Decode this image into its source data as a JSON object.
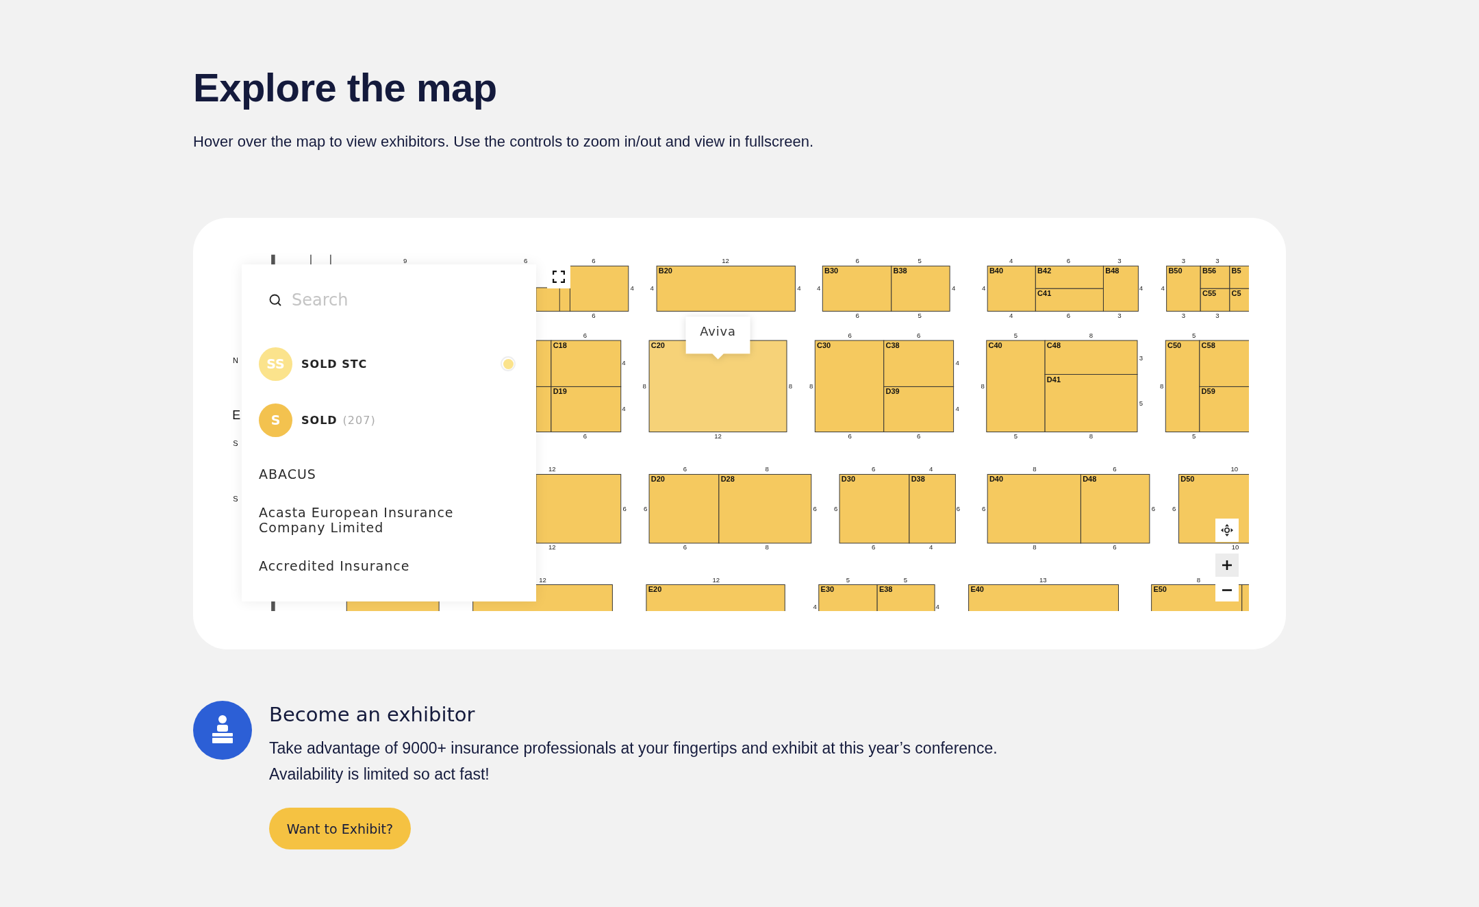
{
  "page": {
    "title": "Explore the map",
    "intro": "Hover over the map to view exhibitors. Use the controls to zoom in/out and view in fullscreen."
  },
  "map": {
    "search": {
      "placeholder": "Search"
    },
    "legend": [
      {
        "initials": "SS",
        "label": "SOLD STC",
        "color": "#fbe38c",
        "selected": true
      },
      {
        "initials": "S",
        "label": "SOLD",
        "count": "(207)",
        "color": "#f3c24f",
        "selected": false
      }
    ],
    "exhibitors": [
      "ABACUS",
      "Acasta European Insurance Company Limited",
      "Accredited Insurance"
    ],
    "edge_labels": [
      "N",
      "E",
      "S",
      "S"
    ],
    "tooltip": "Aviva",
    "stands": [
      {
        "booths": [
          {
            "highlighted": false
          },
          {
            "highlighted": false
          }
        ],
        "dims": [
          "6",
          "6",
          "4",
          "6"
        ]
      },
      {
        "booths": [
          {
            "label": "B20",
            "highlighted": false
          }
        ],
        "dims": [
          "12",
          "4",
          "4"
        ]
      },
      {
        "booths": [
          {
            "label": "B30",
            "highlighted": false
          },
          {
            "label": "B38",
            "highlighted": false
          }
        ],
        "dims": [
          "6",
          "5",
          "4",
          "4",
          "6",
          "5"
        ]
      },
      {
        "booths": [
          {
            "label": "B40",
            "highlighted": false
          },
          {
            "label": "B42",
            "highlighted": false
          },
          {
            "label": "C41",
            "highlighted": false
          },
          {
            "label": "B48",
            "highlighted": false
          }
        ],
        "dims": [
          "4",
          "6",
          "3",
          "4",
          "4",
          "4",
          "6",
          "3"
        ]
      },
      {
        "booths": [
          {
            "label": "B50",
            "highlighted": false
          },
          {
            "label": "B56",
            "highlighted": false
          },
          {
            "label": "C55",
            "highlighted": false
          },
          {
            "label": "B5",
            "highlighted": false
          },
          {
            "label": "C5",
            "highlighted": false
          }
        ],
        "dims": [
          "3",
          "3",
          "4",
          "3",
          "3"
        ]
      },
      {
        "booths": [
          {
            "highlighted": false
          },
          {
            "highlighted": false
          },
          {
            "label": "C18",
            "highlighted": false
          },
          {
            "label": "D19",
            "highlighted": false
          }
        ],
        "dims": [
          "6",
          "4",
          "4",
          "6"
        ]
      },
      {
        "booths": [
          {
            "label": "C20",
            "highlighted": true
          }
        ],
        "dims": [
          "8",
          "8",
          "12"
        ]
      },
      {
        "booths": [
          {
            "label": "C30",
            "highlighted": false
          },
          {
            "label": "C38",
            "highlighted": false
          },
          {
            "label": "D39",
            "highlighted": false
          }
        ],
        "dims": [
          "6",
          "6",
          "8",
          "4",
          "4",
          "6",
          "6"
        ]
      },
      {
        "booths": [
          {
            "label": "C40",
            "highlighted": false
          },
          {
            "label": "C48",
            "highlighted": false
          },
          {
            "label": "D41",
            "highlighted": false
          }
        ],
        "dims": [
          "5",
          "8",
          "8",
          "3",
          "5",
          "5",
          "8"
        ]
      },
      {
        "booths": [
          {
            "label": "C50",
            "highlighted": false
          },
          {
            "label": "C58",
            "highlighted": false
          },
          {
            "label": "D59",
            "highlighted": false
          }
        ],
        "dims": [
          "5",
          "8",
          "5"
        ]
      },
      {
        "booths": [
          {
            "highlighted": false
          }
        ],
        "dims": [
          "12",
          "6",
          "12"
        ]
      },
      {
        "booths": [
          {
            "label": "D20",
            "highlighted": false
          },
          {
            "label": "D28",
            "highlighted": false
          }
        ],
        "dims": [
          "6",
          "8",
          "6",
          "6",
          "6",
          "8"
        ]
      },
      {
        "booths": [
          {
            "label": "D30",
            "highlighted": false
          },
          {
            "label": "D38",
            "highlighted": false
          }
        ],
        "dims": [
          "6",
          "4",
          "6",
          "6",
          "6",
          "4"
        ]
      },
      {
        "booths": [
          {
            "label": "D40",
            "highlighted": false
          },
          {
            "label": "D48",
            "highlighted": false
          }
        ],
        "dims": [
          "8",
          "6",
          "6",
          "6",
          "8",
          "6"
        ]
      },
      {
        "booths": [
          {
            "label": "D50",
            "highlighted": false
          }
        ],
        "dims": [
          "10",
          "6",
          "10"
        ]
      },
      {
        "booths": [
          {
            "highlighted": false
          }
        ]
      },
      {
        "booths": [
          {
            "highlighted": false
          }
        ],
        "dims": [
          "12"
        ]
      },
      {
        "booths": [
          {
            "label": "E20",
            "highlighted": false
          }
        ],
        "dims": [
          "12"
        ]
      },
      {
        "booths": [
          {
            "label": "E30",
            "highlighted": false
          },
          {
            "label": "E38",
            "highlighted": false
          }
        ],
        "dims": [
          "5",
          "5",
          "4",
          "4"
        ]
      },
      {
        "booths": [
          {
            "label": "E40",
            "highlighted": false
          }
        ],
        "dims": [
          "13"
        ]
      },
      {
        "booths": [
          {
            "label": "E50",
            "highlighted": false
          },
          {
            "highlighted": false
          }
        ],
        "dims": [
          "8"
        ]
      },
      {
        "dims": [
          "9"
        ]
      }
    ]
  },
  "cta": {
    "heading": "Become an exhibitor",
    "text": "Take advantage of 9000+ insurance professionals at your fingertips and exhibit at this year’s conference. Availability is limited so act fast!",
    "button": "Want to Exhibit?"
  }
}
